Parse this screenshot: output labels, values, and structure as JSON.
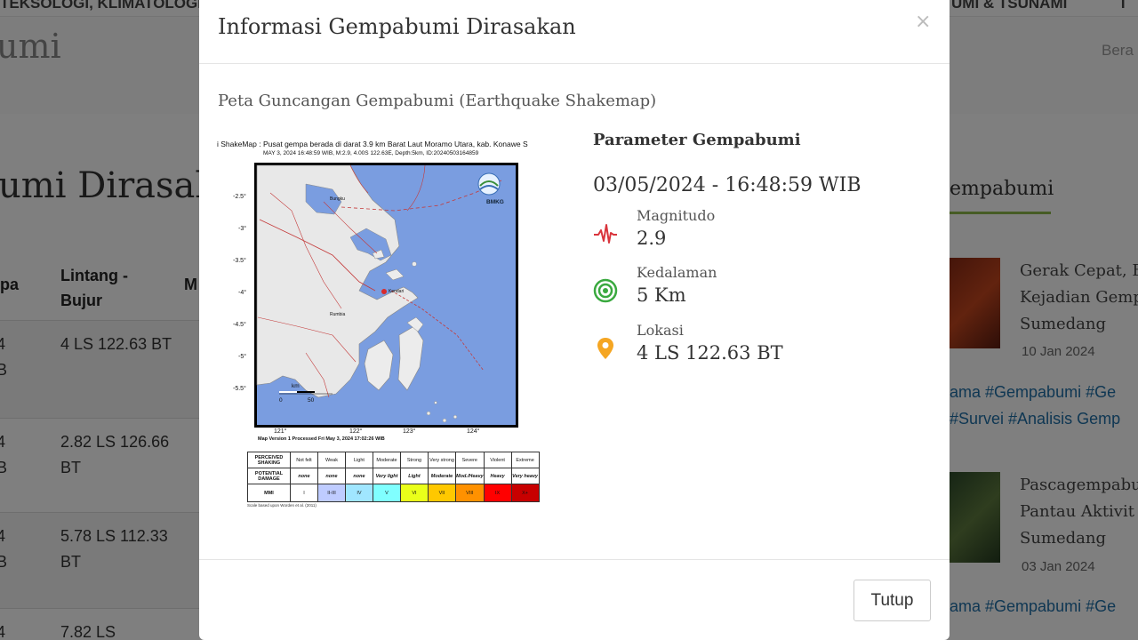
{
  "background": {
    "topbar": {
      "left_text": "TEKSOLOGI, KLIMATOLOGI",
      "right_text": "UMI & TSUNAMI",
      "far_right": "T"
    },
    "site_title_fragment": "umi",
    "breadcrumb_fragment": "Bera",
    "page_title_fragment": "umi Dirasakan",
    "table": {
      "headers": [
        "pa",
        "Lintang - Bujur",
        "M"
      ],
      "rows": [
        {
          "c1": "4 B",
          "c2": "4 LS 122.63 BT"
        },
        {
          "c1": "4 B",
          "c2": "2.82 LS 126.66 BT"
        },
        {
          "c1": "4 B",
          "c2": "5.78 LS 112.33 BT"
        },
        {
          "c1": "4",
          "c2": "7.82 LS"
        }
      ]
    },
    "sidebar": {
      "heading": "empabumi",
      "news": [
        {
          "title_lines": [
            "Gerak Cepat, B",
            "Kejadian Gemp",
            "Sumedang"
          ],
          "date": "10 Jan 2024"
        },
        {
          "title_lines": [
            "Pascagempabu",
            "Pantau Aktivit",
            "Sumedang"
          ],
          "date": "03 Jan 2024"
        }
      ],
      "tags_1": [
        "ama #Gempabumi #Ge",
        "#Survei #Analisis Gemp"
      ],
      "tags_2": "ama #Gempabumi #Ge"
    }
  },
  "modal": {
    "title": "Informasi Gempabumi Dirasakan",
    "close_symbol": "×",
    "map_heading": "Peta Guncangan Gempabumi (Earthquake Shakemap)",
    "shakemap": {
      "title_line": "i ShakeMap : Pusat gempa berada di darat 3.9 km Barat Laut Moramo Utara, kab. Konawe S",
      "sub_line": "MAY 3, 2024 16:48:59 WIB, M:2.9, 4.00S 122.63E, Depth:5km, ID:20240503164859",
      "logo_text": "BMKG",
      "lat_ticks": [
        "-2.5°",
        "-3°",
        "-3.5°",
        "-4°",
        "-4.5°",
        "-5°",
        "-5.5°"
      ],
      "lon_ticks": [
        "121°",
        "122°",
        "123°",
        "124°"
      ],
      "scale_unit": "km",
      "scale_ticks": [
        "0",
        "50"
      ],
      "places": [
        "Bungku",
        "Kendari",
        "Rumbia"
      ],
      "version_line": "Map Version 1 Processed Fri May 3, 2024 17:02:26 WIB",
      "legend": {
        "rows": [
          {
            "header": "PERCEIVED SHAKING",
            "cells": [
              "Not felt",
              "Weak",
              "Light",
              "Moderate",
              "Strong",
              "Very strong",
              "Severe",
              "Violent",
              "Extreme"
            ]
          },
          {
            "header": "POTENTIAL DAMAGE",
            "cells": [
              "none",
              "none",
              "none",
              "Very light",
              "Light",
              "Moderate",
              "Mod./Heavy",
              "Heavy",
              "Very heavy"
            ]
          },
          {
            "header": "MMI",
            "cells": [
              "I",
              "II-III",
              "IV",
              "V",
              "VI",
              "VII",
              "VIII",
              "IX",
              "X+"
            ]
          }
        ],
        "mmi_colors": [
          "#ffffff",
          "#bfccff",
          "#a0e6ff",
          "#80ffff",
          "#eaff1a",
          "#ffc800",
          "#ff9100",
          "#ff0000",
          "#c80000"
        ],
        "note": "Scale based upon Worden et al. (2011)"
      }
    },
    "params": {
      "title": "Parameter Gempabumi",
      "datetime": "03/05/2024 - 16:48:59 WIB",
      "items": [
        {
          "icon": "seismograph-icon",
          "label": "Magnitudo",
          "value": "2.9",
          "color": "#d9343c"
        },
        {
          "icon": "depth-icon",
          "label": "Kedalaman",
          "value": "5 Km",
          "color": "#3aa93f"
        },
        {
          "icon": "location-pin-icon",
          "label": "Lokasi",
          "value": "4 LS 122.63 BT",
          "color": "#f5a623"
        }
      ]
    },
    "footer": {
      "close_button": "Tutup"
    }
  }
}
